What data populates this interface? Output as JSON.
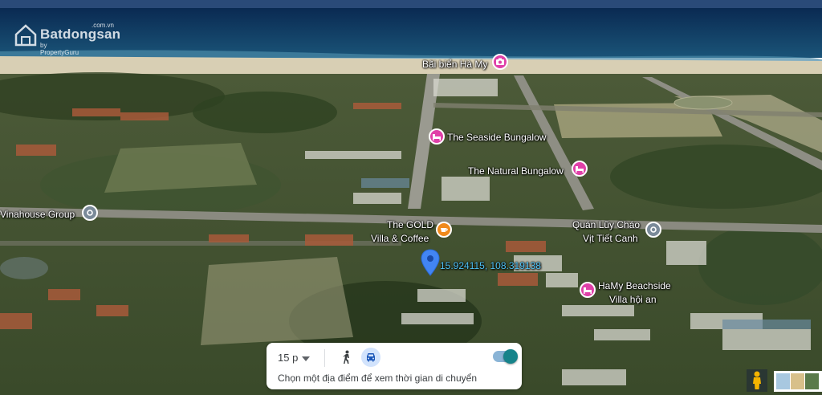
{
  "watermark": {
    "name": "Batdongsan",
    "sub": "by PropertyGuru",
    "domain": ".com.vn"
  },
  "places": [
    {
      "label": "Bãi biển Hà My",
      "icon": "camera-icon",
      "color": "#e040a8"
    },
    {
      "label": "The Seaside Bungalow",
      "icon": "bed-icon",
      "color": "#e040a8"
    },
    {
      "label": "The Natural Bungalow",
      "icon": "bed-icon",
      "color": "#e040a8"
    },
    {
      "label": "Vinahouse Group",
      "icon": "location-icon",
      "color": "#7a8a99"
    },
    {
      "label": "The GOLD",
      "label2": "Villa & Coffee",
      "icon": "coffee-icon",
      "color": "#f08a1c"
    },
    {
      "label": "Quán Lũy Cháo",
      "label2": "Vịt Tiết Canh",
      "icon": "location-icon",
      "color": "#7a8a99"
    },
    {
      "label": "HaMy Beachside",
      "label2": "Villa hội an",
      "icon": "bed-icon",
      "color": "#e040a8"
    }
  ],
  "marker": {
    "coordinates": "15.924115, 108.319138",
    "color": "#4285f4"
  },
  "travel_panel": {
    "time": "15 p",
    "hint": "Chọn một địa điểm để xem thời gian di chuyển"
  }
}
